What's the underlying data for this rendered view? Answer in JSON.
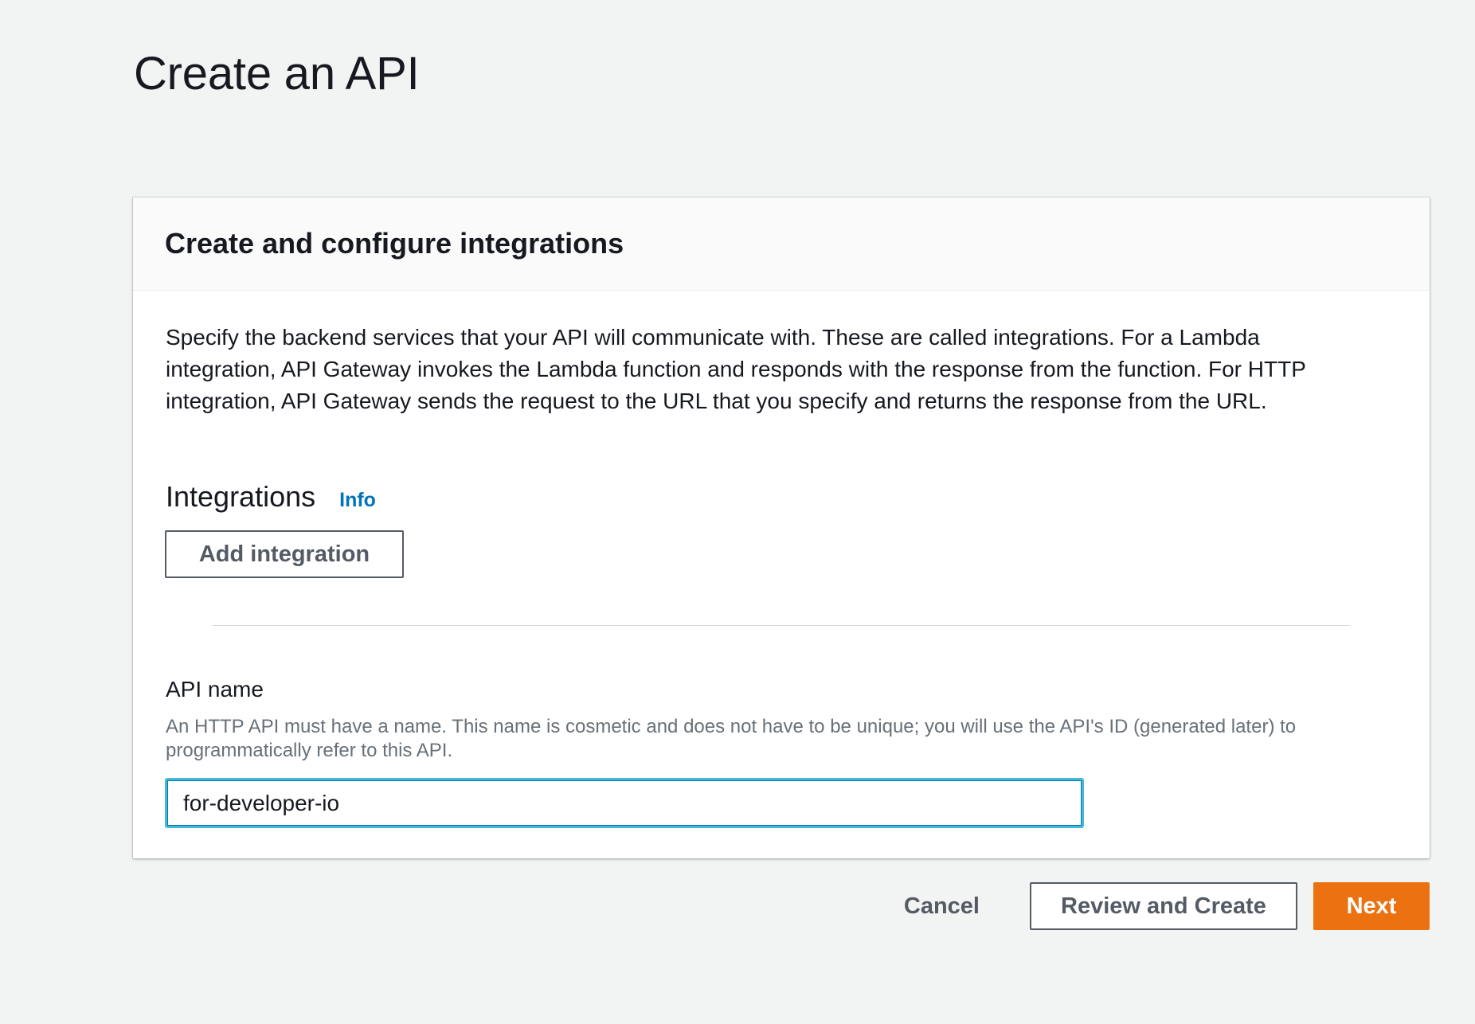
{
  "page": {
    "title": "Create an API"
  },
  "panel": {
    "title": "Create and configure integrations",
    "description": "Specify the backend services that your API will communicate with. These are called integrations. For a Lambda integration, API Gateway invokes the Lambda function and responds with the response from the function. For HTTP integration, API Gateway sends the request to the URL that you specify and returns the response from the URL."
  },
  "integrations": {
    "heading": "Integrations",
    "info_label": "Info",
    "add_button_label": "Add integration"
  },
  "api_name": {
    "label": "API name",
    "description": "An HTTP API must have a name. This name is cosmetic and does not have to be unique; you will use the API's ID (generated later) to programmatically refer to this API.",
    "value": "for-developer-io"
  },
  "actions": {
    "cancel_label": "Cancel",
    "review_label": "Review and Create",
    "next_label": "Next"
  },
  "colors": {
    "page_background": "#f2f3f3",
    "primary_button": "#ec7211",
    "link": "#0073bb",
    "input_focus_border": "#44b9d6"
  }
}
